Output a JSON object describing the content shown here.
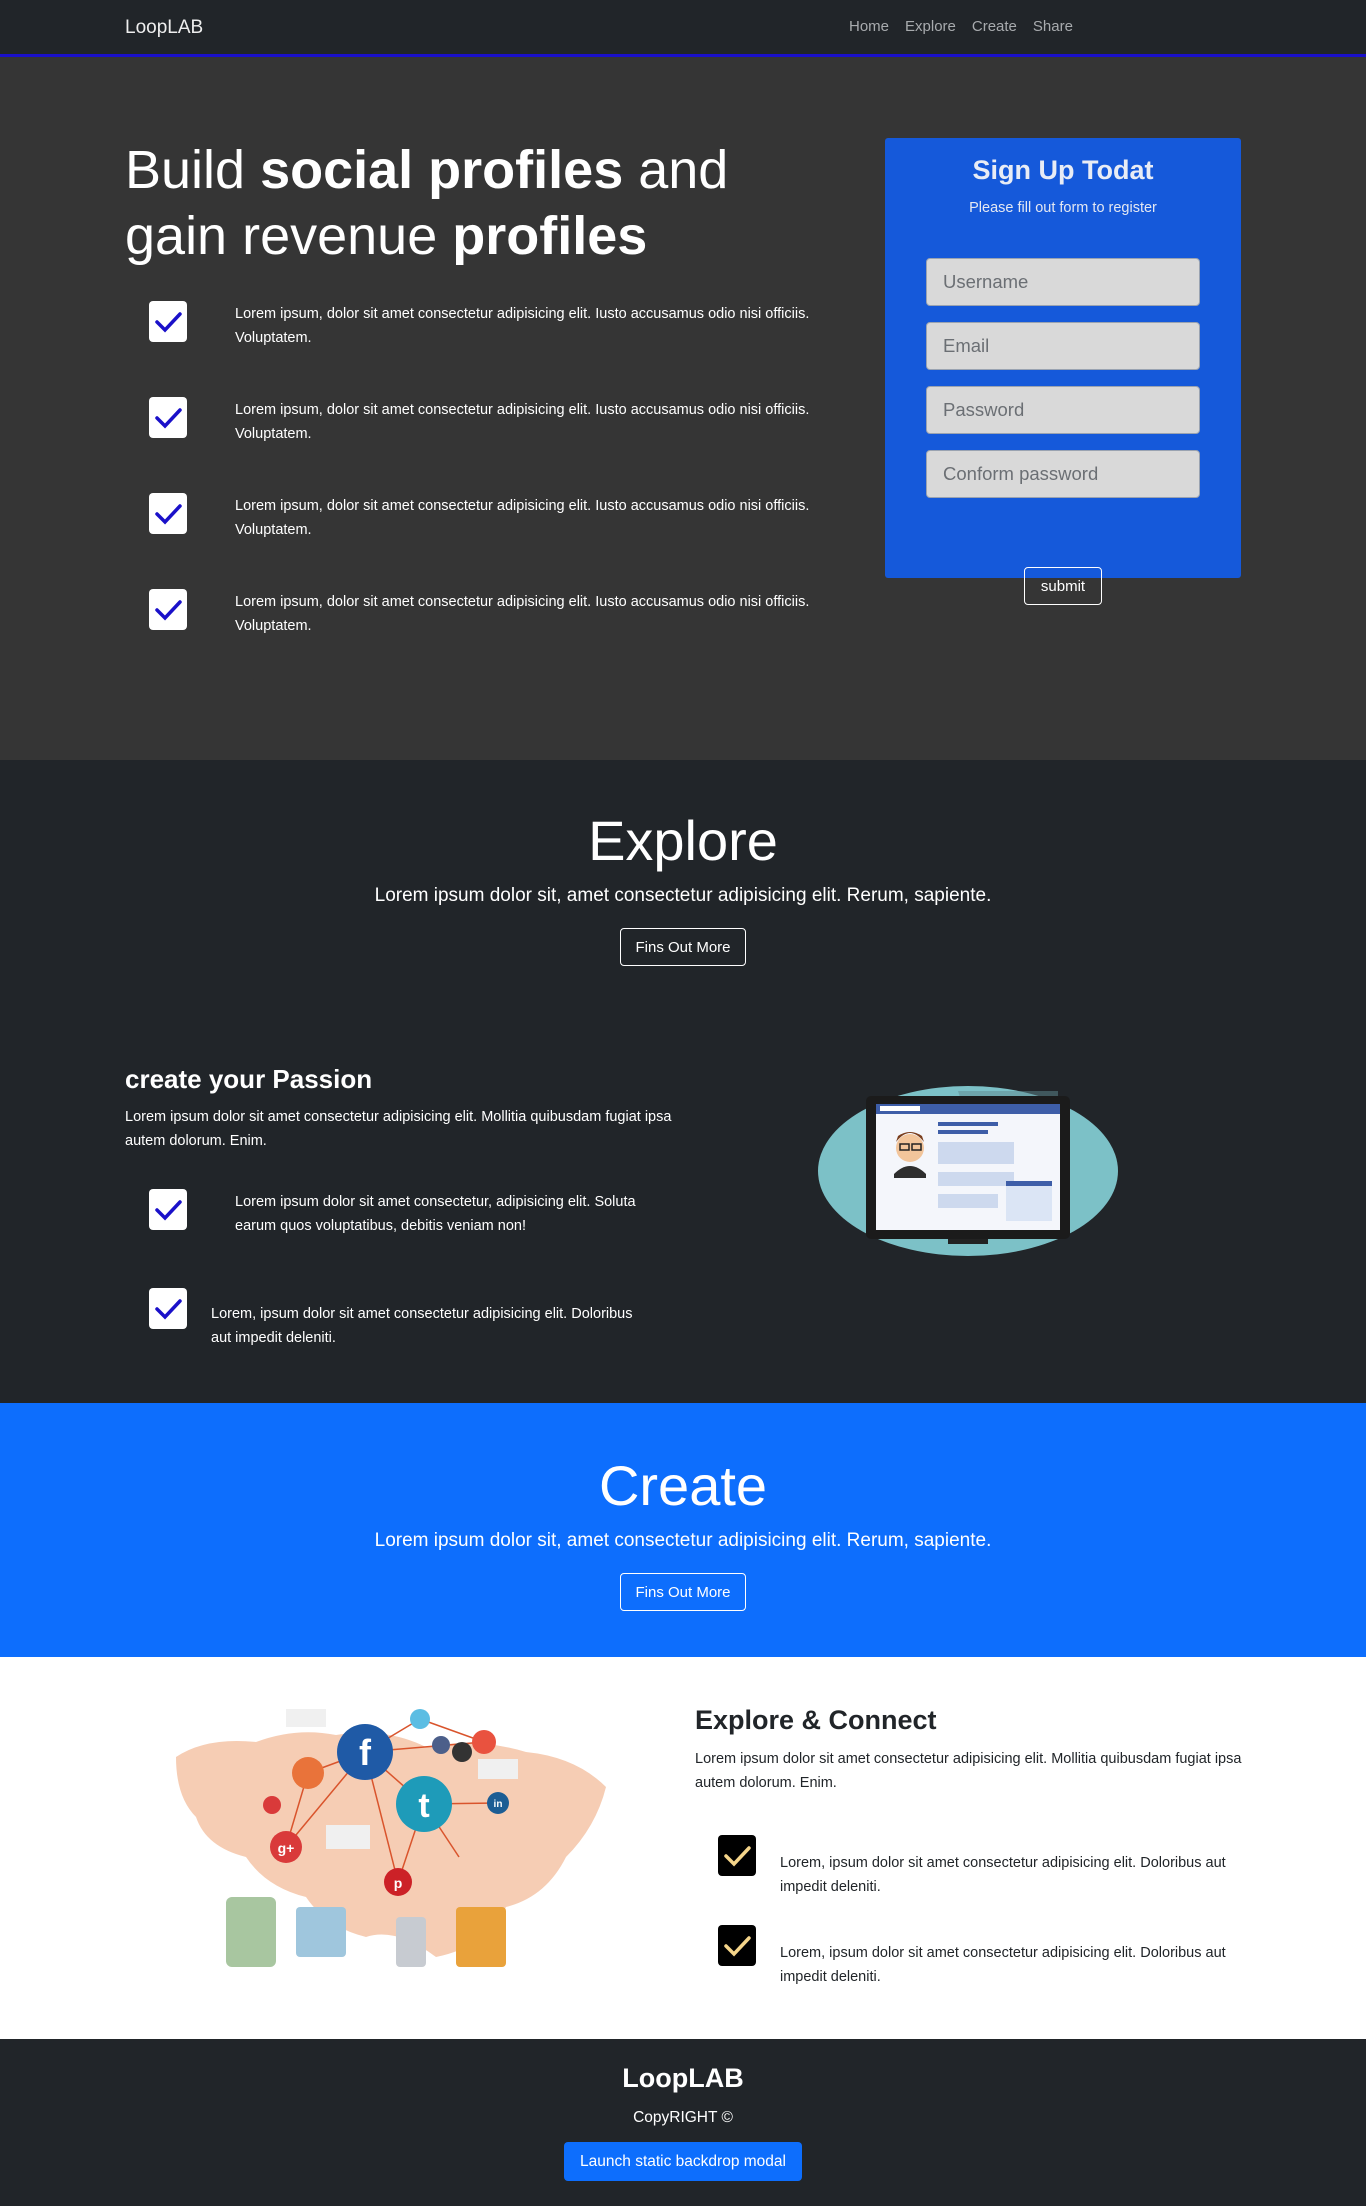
{
  "nav": {
    "brand": "LoopLAB",
    "links": [
      "Home",
      "Explore",
      "Create",
      "Share"
    ]
  },
  "hero": {
    "title_parts": [
      "Build ",
      "social profiles",
      " and gain revenue ",
      "profiles"
    ],
    "features": [
      "Lorem ipsum, dolor sit amet consectetur adipisicing elit. Iusto accusamus odio nisi officiis. Voluptatem.",
      "Lorem ipsum, dolor sit amet consectetur adipisicing elit. Iusto accusamus odio nisi officiis. Voluptatem.",
      "Lorem ipsum, dolor sit amet consectetur adipisicing elit. Iusto accusamus odio nisi officiis. Voluptatem.",
      "Lorem ipsum, dolor sit amet consectetur adipisicing elit. Iusto accusamus odio nisi officiis. Voluptatem."
    ]
  },
  "signup": {
    "title": "Sign Up Todat",
    "subtitle": "Please fill out form to register",
    "username_placeholder": "Username",
    "email_placeholder": "Email",
    "password_placeholder": "Password",
    "confirm_placeholder": "Conform password",
    "submit_label": "submit"
  },
  "explore": {
    "title": "Explore",
    "subtitle": "Lorem ipsum dolor sit, amet consectetur adipisicing elit. Rerum, sapiente.",
    "button": "Fins Out More",
    "passion_title": "create your Passion",
    "passion_text": "Lorem ipsum dolor sit amet consectetur adipisicing elit. Mollitia quibusdam fugiat ipsa autem dolorum. Enim.",
    "features": [
      "Lorem ipsum dolor sit amet consectetur, adipisicing elit. Soluta earum quos voluptatibus, debitis veniam non!",
      "Lorem, ipsum dolor sit amet consectetur adipisicing elit. Doloribus aut impedit deleniti."
    ]
  },
  "create": {
    "title": "Create",
    "subtitle": "Lorem ipsum dolor sit, amet consectetur adipisicing elit. Rerum, sapiente.",
    "button": "Fins Out More"
  },
  "connect": {
    "title": "Explore & Connect",
    "text": "Lorem ipsum dolor sit amet consectetur adipisicing elit. Mollitia quibusdam fugiat ipsa autem dolorum. Enim.",
    "features": [
      "Lorem, ipsum dolor sit amet consectetur adipisicing elit. Doloribus aut impedit deleniti.",
      "Lorem, ipsum dolor sit amet consectetur adipisicing elit. Doloribus aut impedit deleniti."
    ]
  },
  "footer": {
    "brand": "LoopLAB",
    "copyright": "CopyRIGHT ©",
    "modal_button": "Launch static backdrop modal"
  },
  "colors": {
    "nav_border": "#1a10c9",
    "hero_bg": "#353535",
    "signup_bg": "#1559da",
    "dark_bg": "#212529",
    "create_bg": "#0d6efd",
    "check_blue": "#1a10c9",
    "check_gold": "#f5d58a"
  },
  "icons": {
    "check": "check-icon",
    "laptop": "laptop-profile-illustration",
    "network": "social-network-map-illustration"
  }
}
